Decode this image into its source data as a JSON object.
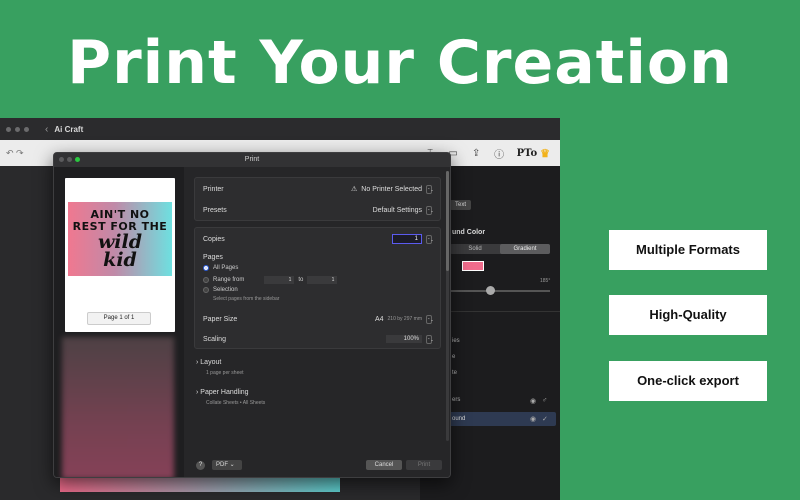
{
  "headline": "Print Your Creation",
  "app": {
    "title": "Ai Craft",
    "toolbar": {
      "pro_label": "PTo"
    },
    "side_panel": {
      "text_button": "Text",
      "bg_color_label": "und Color",
      "seg_solid": "Solid",
      "seg_gradient": "Gradient",
      "angle": "185°",
      "item_a": "ies",
      "item_b": "e",
      "item_c": "te",
      "item_d": "ers",
      "layer_name": "ound",
      "colors": {
        "swatch": "#f06c8c"
      }
    }
  },
  "dialog": {
    "title": "Print",
    "preview": {
      "art_line1": "AIN'T NO",
      "art_line2": "REST FOR THE",
      "art_line3": "wild",
      "art_line4": "kid",
      "page_label": "Page 1 of 1"
    },
    "printer_label": "Printer",
    "printer_value": "No Printer Selected",
    "presets_label": "Presets",
    "presets_value": "Default Settings",
    "copies_label": "Copies",
    "copies_value": "1",
    "pages_label": "Pages",
    "all_pages": "All Pages",
    "range_from": "Range from",
    "range_start": "1",
    "range_to": "to",
    "range_end": "1",
    "selection": "Selection",
    "selection_hint": "Select pages from the sidebar",
    "paper_label": "Paper Size",
    "paper_value": "A4",
    "paper_dims": "210 by 297 mm",
    "scaling_label": "Scaling",
    "scaling_value": "100%",
    "layout_label": "Layout",
    "layout_sub": "1 page per sheet",
    "handling_label": "Paper Handling",
    "handling_sub": "Collate Sheets • All Sheets",
    "help": "?",
    "pdf": "PDF",
    "cancel": "Cancel",
    "print": "Print"
  },
  "features": [
    "Multiple Formats",
    "High-Quality",
    "One-click export"
  ],
  "colors": {
    "background": "#38a060",
    "feature_card": "#ffffff",
    "gradient_start": "#f06c8c",
    "gradient_end": "#5fd2d2"
  }
}
